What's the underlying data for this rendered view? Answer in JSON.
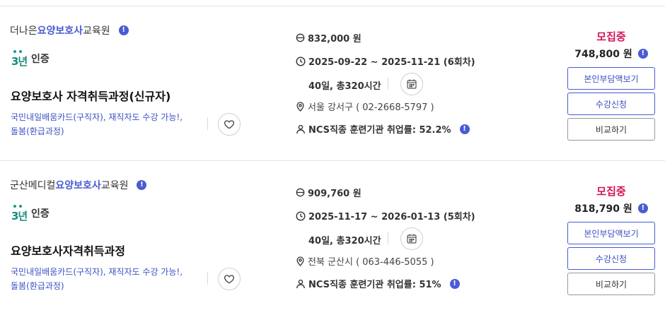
{
  "colors": {
    "accent_blue": "#4a5bd4",
    "tag_blue": "#3b52c4",
    "status_pink": "#d4145a",
    "cert_green": "#1a8c7a",
    "divider": "#e4e4e4"
  },
  "icons": {
    "info": "info-circle-icon",
    "coin": "coin-icon",
    "clock": "clock-icon",
    "calendar": "calendar-icon",
    "location": "location-pin-icon",
    "person": "person-icon",
    "heart": "heart-icon"
  },
  "info_glyph": "!",
  "courses": [
    {
      "org_prefix": "더나은",
      "org_highlight": "요양보호사",
      "org_suffix": "교육원",
      "cert_years": "3년",
      "cert_label": "인증",
      "title": "요양보호사 자격취득과정(신규자)",
      "tags_line1": "국민내일배움카드(구직자), 재직자도 수강 가능!,",
      "tags_line2": "돌봄(환급과정)",
      "price": "832,000 원",
      "period": "2025-09-22 ~ 2025-11-21 (6회차)",
      "hours": "40일, 총320시간",
      "address": "서울 강서구 ( 02-2668-5797 )",
      "ncs": "NCS직종 훈련기관 취업률: 52.2%",
      "status": "모집중",
      "discount_price": "748,800 원",
      "btn_copay": "본인부담액보기",
      "btn_apply": "수강신청",
      "btn_compare": "비교하기"
    },
    {
      "org_prefix": "군산메디컬",
      "org_highlight": "요양보호사",
      "org_suffix": "교육원",
      "cert_years": "3년",
      "cert_label": "인증",
      "title": "요양보호사자격취득과정",
      "tags_line1": "국민내일배움카드(구직자), 재직자도 수강 가능!,",
      "tags_line2": "돌봄(환급과정)",
      "price": "909,760 원",
      "period": "2025-11-17 ~ 2026-01-13 (5회차)",
      "hours": "40일, 총320시간",
      "address": "전북 군산시 ( 063-446-5055 )",
      "ncs": "NCS직종 훈련기관 취업률: 51%",
      "status": "모집중",
      "discount_price": "818,790 원",
      "btn_copay": "본인부담액보기",
      "btn_apply": "수강신청",
      "btn_compare": "비교하기"
    }
  ]
}
